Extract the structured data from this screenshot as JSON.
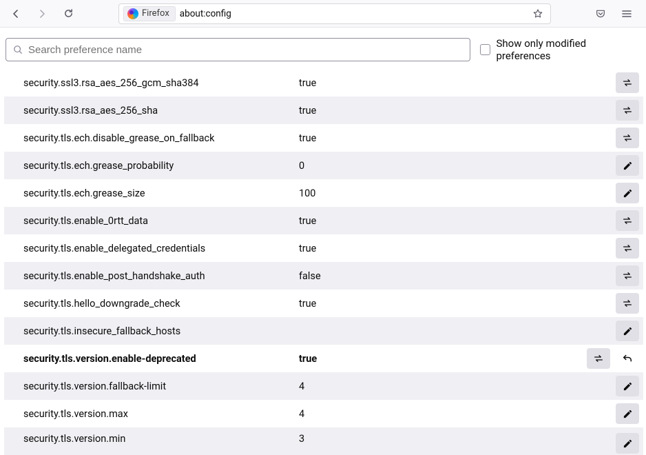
{
  "toolbar": {
    "identity_label": "Firefox",
    "url": "about:config"
  },
  "search": {
    "placeholder": "Search preference name",
    "checkbox_label": "Show only modified preferences"
  },
  "prefs": [
    {
      "name": "security.ssl3.rsa_aes_256_gcm_sha384",
      "value": "true",
      "action": "toggle",
      "modified": false,
      "resettable": false
    },
    {
      "name": "security.ssl3.rsa_aes_256_sha",
      "value": "true",
      "action": "toggle",
      "modified": false,
      "resettable": false
    },
    {
      "name": "security.tls.ech.disable_grease_on_fallback",
      "value": "true",
      "action": "toggle",
      "modified": false,
      "resettable": false
    },
    {
      "name": "security.tls.ech.grease_probability",
      "value": "0",
      "action": "edit",
      "modified": false,
      "resettable": false
    },
    {
      "name": "security.tls.ech.grease_size",
      "value": "100",
      "action": "edit",
      "modified": false,
      "resettable": false
    },
    {
      "name": "security.tls.enable_0rtt_data",
      "value": "true",
      "action": "toggle",
      "modified": false,
      "resettable": false
    },
    {
      "name": "security.tls.enable_delegated_credentials",
      "value": "true",
      "action": "toggle",
      "modified": false,
      "resettable": false
    },
    {
      "name": "security.tls.enable_post_handshake_auth",
      "value": "false",
      "action": "toggle",
      "modified": false,
      "resettable": false
    },
    {
      "name": "security.tls.hello_downgrade_check",
      "value": "true",
      "action": "toggle",
      "modified": false,
      "resettable": false
    },
    {
      "name": "security.tls.insecure_fallback_hosts",
      "value": "",
      "action": "edit",
      "modified": false,
      "resettable": false
    },
    {
      "name": "security.tls.version.enable-deprecated",
      "value": "true",
      "action": "toggle",
      "modified": true,
      "resettable": true
    },
    {
      "name": "security.tls.version.fallback-limit",
      "value": "4",
      "action": "edit",
      "modified": false,
      "resettable": false
    },
    {
      "name": "security.tls.version.max",
      "value": "4",
      "action": "edit",
      "modified": false,
      "resettable": false
    },
    {
      "name": "security.tls.version.min",
      "value": "3",
      "action": "edit",
      "modified": false,
      "resettable": false
    }
  ]
}
